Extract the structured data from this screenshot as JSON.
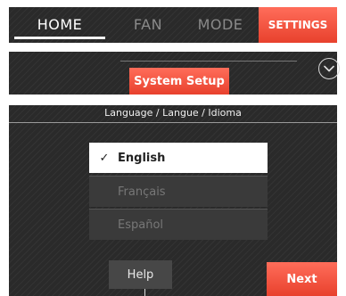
{
  "nav": {
    "tabs": [
      {
        "label": "HOME"
      },
      {
        "label": "FAN"
      },
      {
        "label": "MODE"
      }
    ],
    "settings_label": "SETTINGS"
  },
  "menu": {
    "selected_item": "System Setup"
  },
  "language_screen": {
    "title": "Language / Langue / Idioma",
    "options": [
      {
        "label": "English",
        "selected": true,
        "check": "✓"
      },
      {
        "label": "Français",
        "selected": false
      },
      {
        "label": "Español",
        "selected": false
      }
    ],
    "help_label": "Help",
    "next_label": "Next"
  },
  "colors": {
    "accent": "#e8412d",
    "panel": "#2a2a2a"
  },
  "icons": {
    "chevron": "chevron-down-icon",
    "check": "checkmark-icon"
  }
}
